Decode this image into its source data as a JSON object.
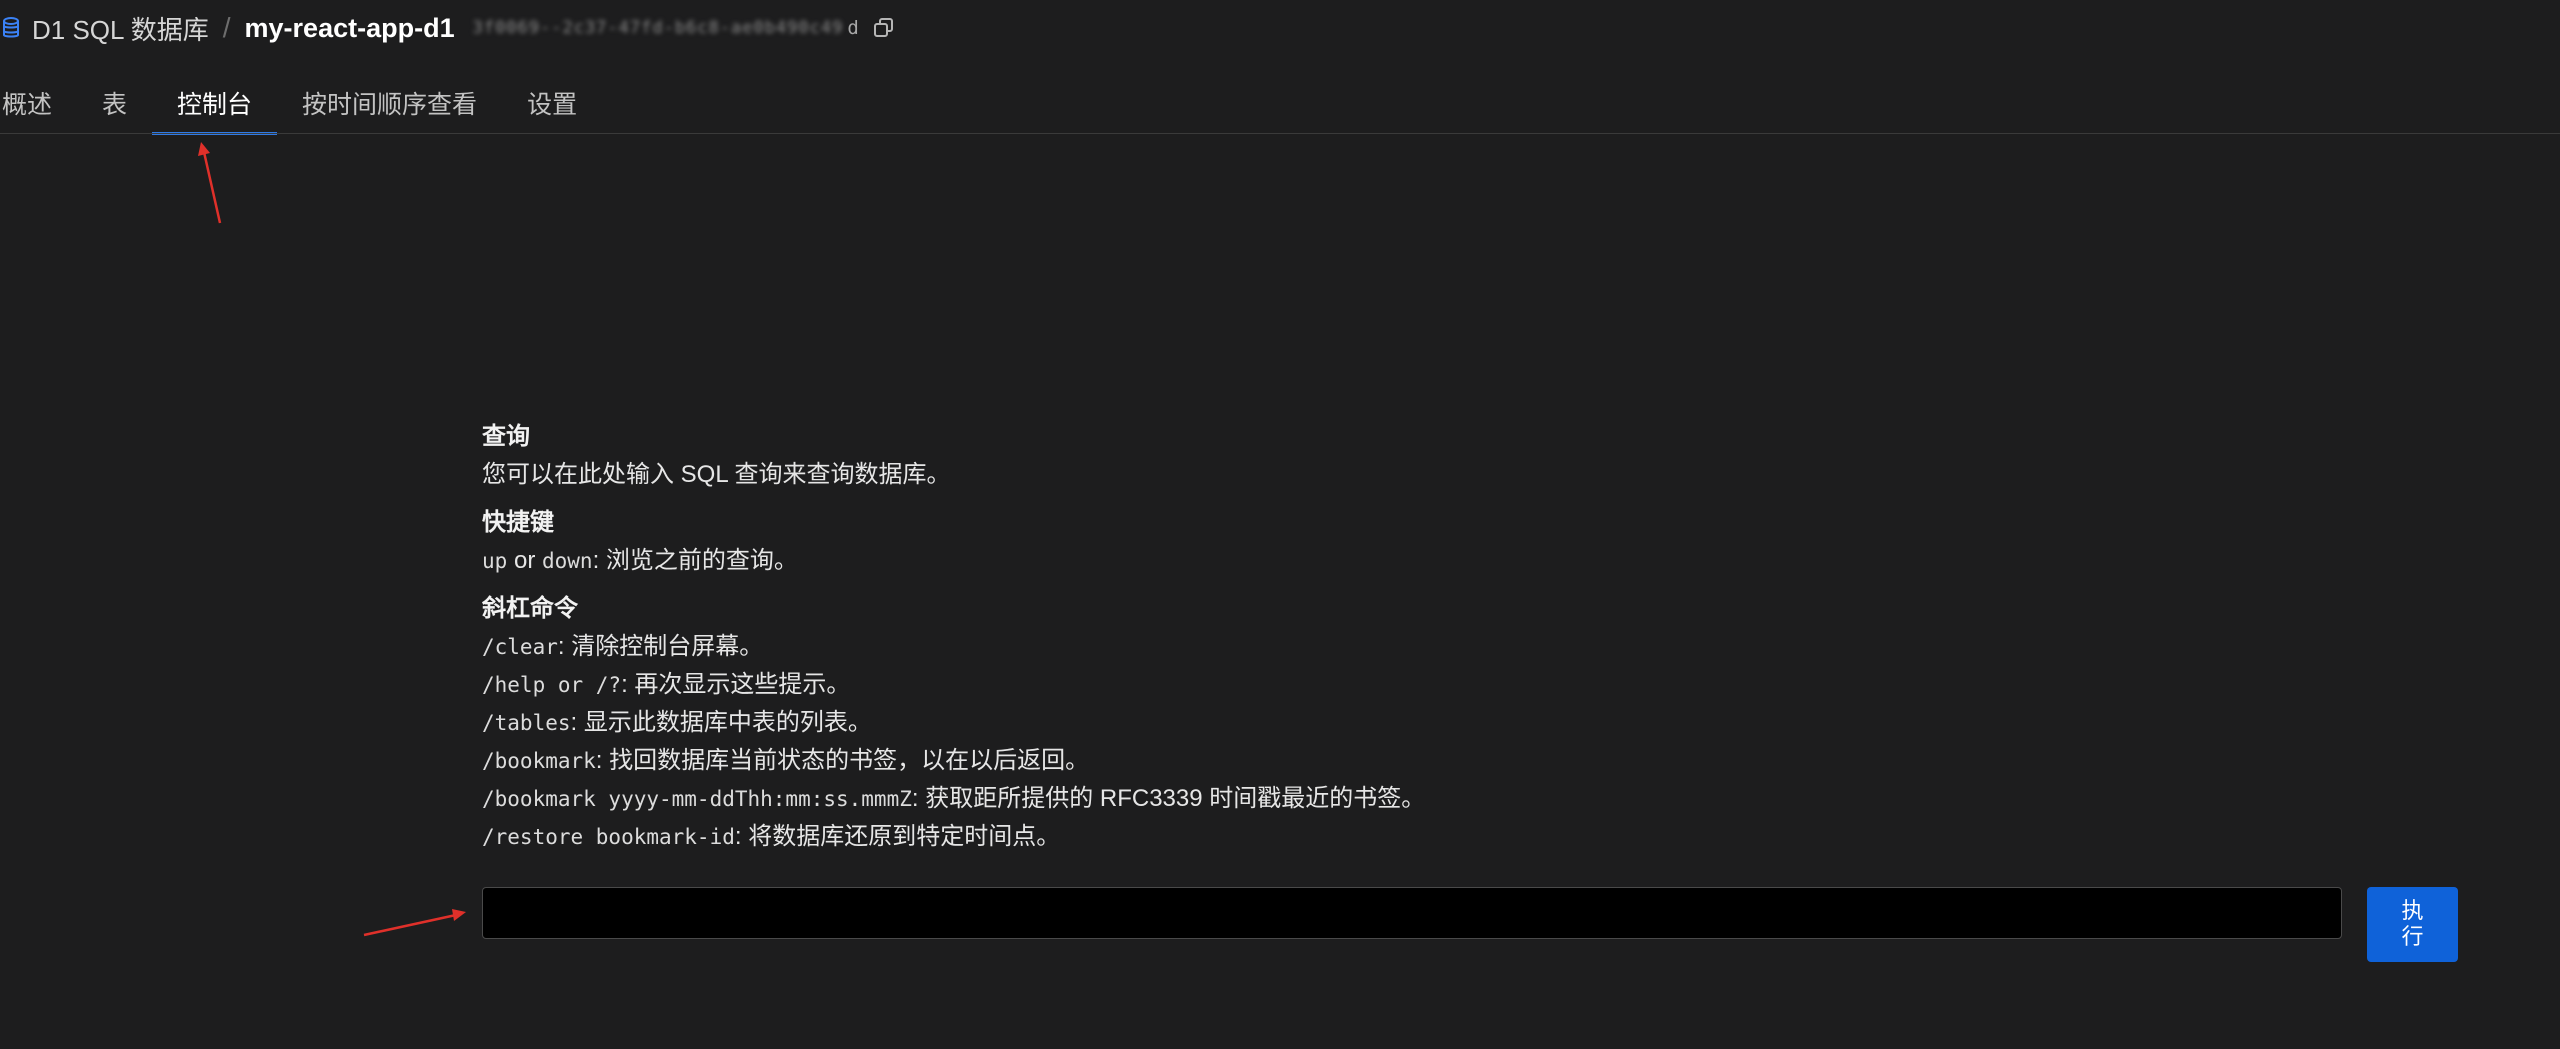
{
  "header": {
    "product": "D1 SQL 数据库",
    "separator": "/",
    "database_name": "my-react-app-d1",
    "database_id_masked": "3f0069--2c37-47fd-b6c8-ae0b490c49",
    "database_id_end": "d"
  },
  "tabs": [
    {
      "label": "概述",
      "active": false
    },
    {
      "label": "表",
      "active": false
    },
    {
      "label": "控制台",
      "active": true
    },
    {
      "label": "按时间顺序查看",
      "active": false
    },
    {
      "label": "设置",
      "active": false
    }
  ],
  "help": {
    "query": {
      "title": "查询",
      "text": "您可以在此处输入 SQL 查询来查询数据库。"
    },
    "shortcuts": {
      "title": "快捷键",
      "key_up": "up",
      "or": " or ",
      "key_down": "down",
      "text": ": 浏览之前的查询。"
    },
    "slash": {
      "title": "斜杠命令",
      "commands": [
        {
          "cmd": "/clear",
          "desc": ": 清除控制台屏幕。"
        },
        {
          "cmd": "/help or /?",
          "desc": ": 再次显示这些提示。"
        },
        {
          "cmd": "/tables",
          "desc": ": 显示此数据库中表的列表。"
        },
        {
          "cmd": "/bookmark",
          "desc": ": 找回数据库当前状态的书签，以在以后返回。"
        },
        {
          "cmd": "/bookmark yyyy-mm-ddThh:mm:ss.mmmZ",
          "desc": ": 获取距所提供的 RFC3339 时间戳最近的书签。"
        },
        {
          "cmd": "/restore bookmark-id",
          "desc": ": 将数据库还原到特定时间点。"
        }
      ]
    }
  },
  "console": {
    "input_value": "",
    "run_label": "执行"
  },
  "colors": {
    "background": "#1d1d1e",
    "accent": "#2f7ae5",
    "button": "#0f62d9",
    "annotation": "#e0302a"
  }
}
